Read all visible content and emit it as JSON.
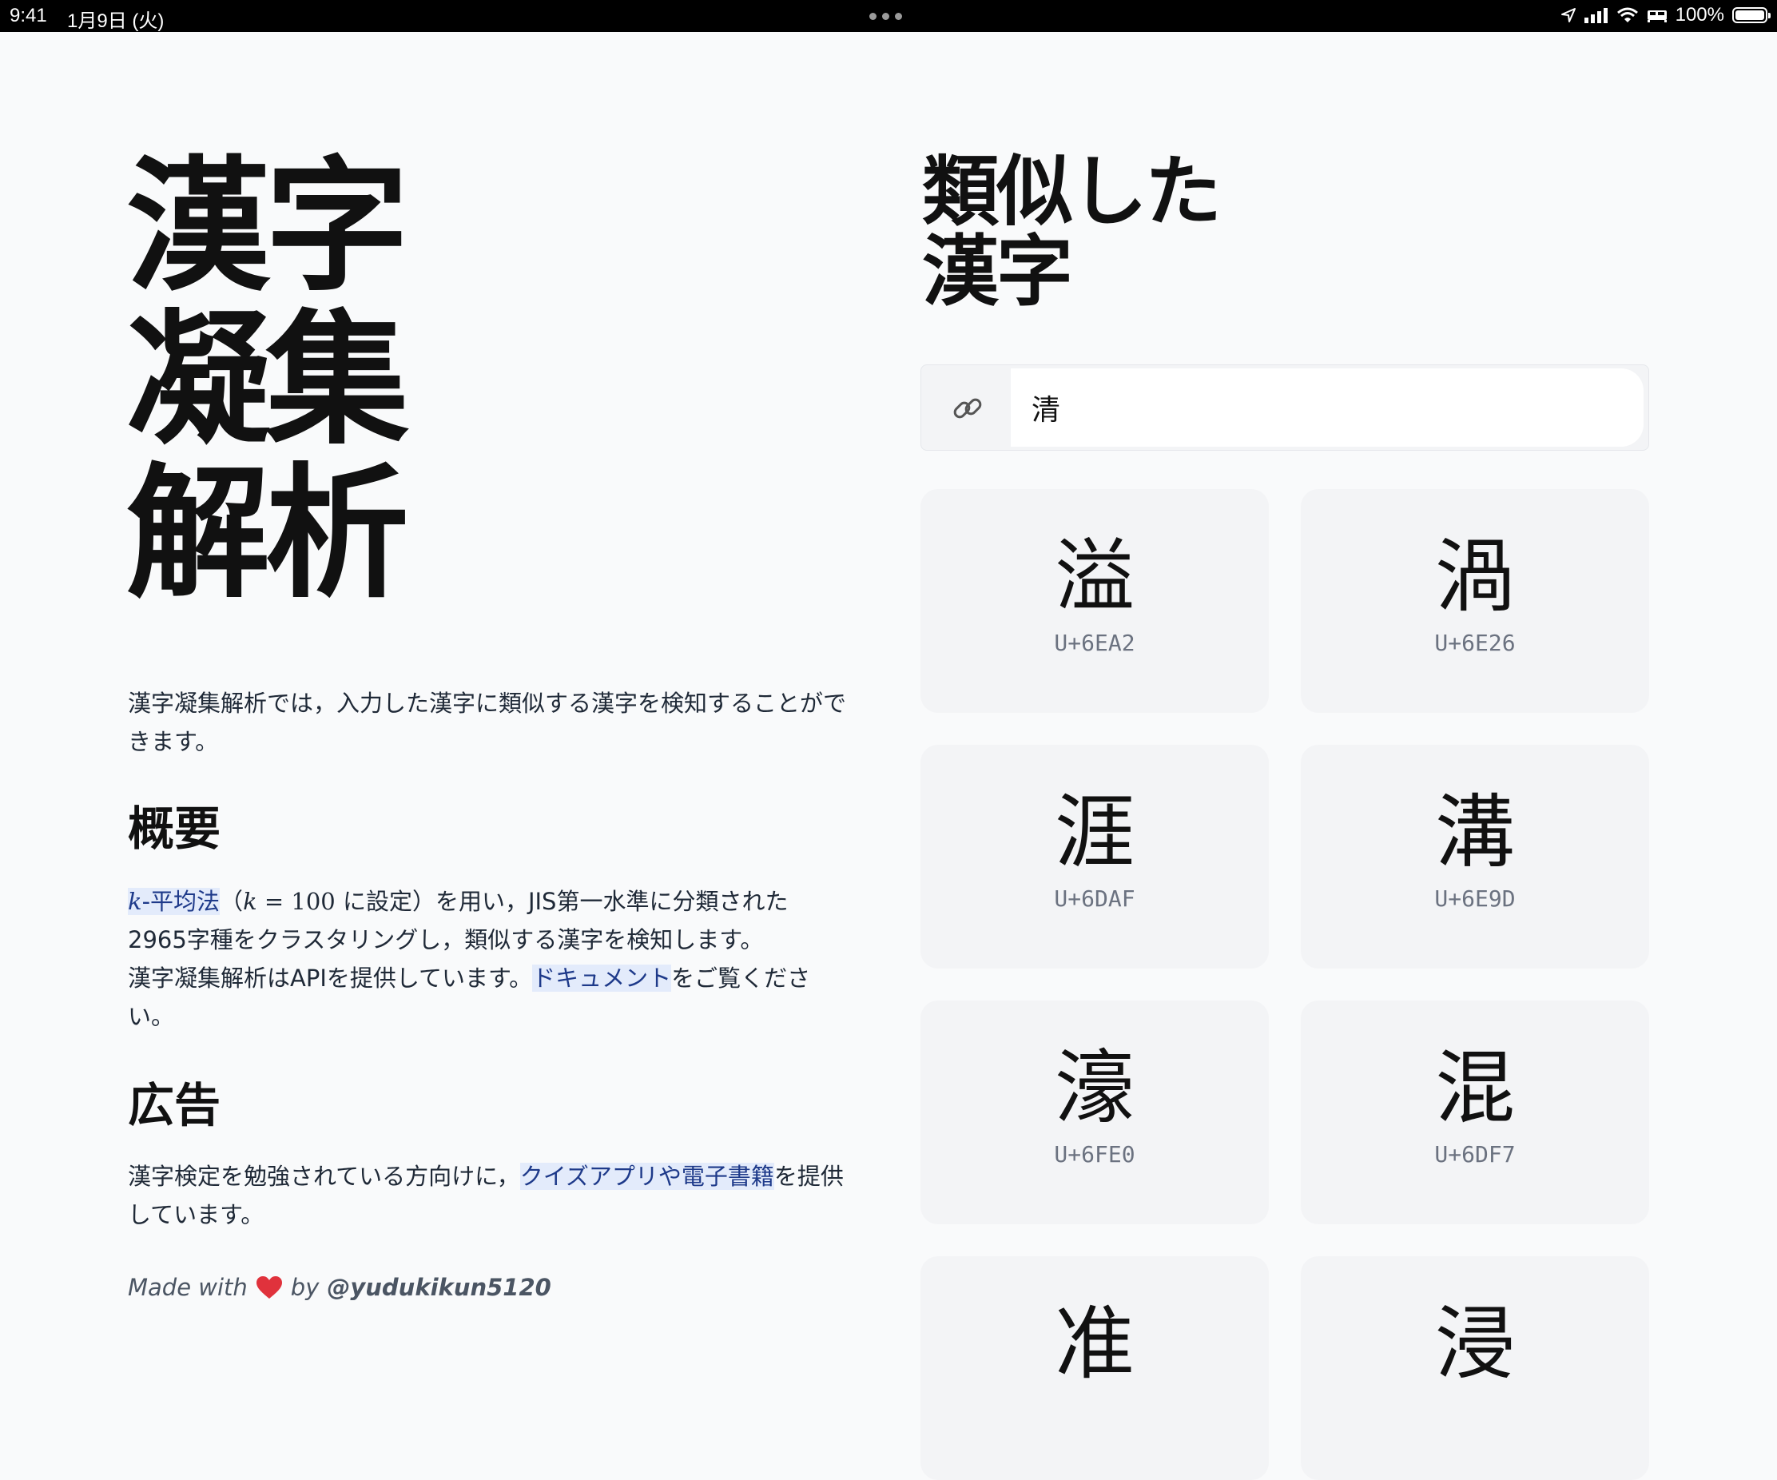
{
  "status": {
    "time": "9:41",
    "date": "1月9日 (火)",
    "battery": "100%"
  },
  "hero": {
    "lines": [
      "漢字",
      "凝集",
      "解析"
    ]
  },
  "intro": "漢字凝集解析では，入力した漢字に類似する漢字を検知することができます。",
  "overview": {
    "heading": "概要",
    "kmeans_k": "k",
    "kmeans_link": "-平均法",
    "param_open": "（",
    "param_k": "k",
    "param_eq": " = 100",
    "param_rest": " に設定）を用い，JIS第一水準に分類された2965字種をクラスタリングし，類似する漢字を検知します。",
    "api_text": "漢字凝集解析はAPIを提供しています。",
    "doc_link": "ドキュメント",
    "doc_after": "をご覧ください。"
  },
  "ads": {
    "heading": "広告",
    "before": "漢字検定を勉強されている方向けに，",
    "link1": "クイズアプリ",
    "mid": "や",
    "link2": "電子書籍",
    "after": "を提供しています。"
  },
  "footer": {
    "made_with": "Made with",
    "by": "by",
    "handle": "@yudukikun5120"
  },
  "similar": {
    "title_line1": "類似した",
    "title_line2": "漢字",
    "input_value": "清",
    "link_icon": "link-icon",
    "cards": [
      {
        "char": "溢",
        "code": "U+6EA2"
      },
      {
        "char": "渦",
        "code": "U+6E26"
      },
      {
        "char": "涯",
        "code": "U+6DAF"
      },
      {
        "char": "溝",
        "code": "U+6E9D"
      },
      {
        "char": "濠",
        "code": "U+6FE0"
      },
      {
        "char": "混",
        "code": "U+6DF7"
      },
      {
        "char": "准",
        "code": ""
      },
      {
        "char": "浸",
        "code": ""
      }
    ]
  },
  "colors": {
    "highlight_bg": "#e3ebfb",
    "card_bg": "#f3f4f6",
    "page_bg": "#f9fafb"
  }
}
